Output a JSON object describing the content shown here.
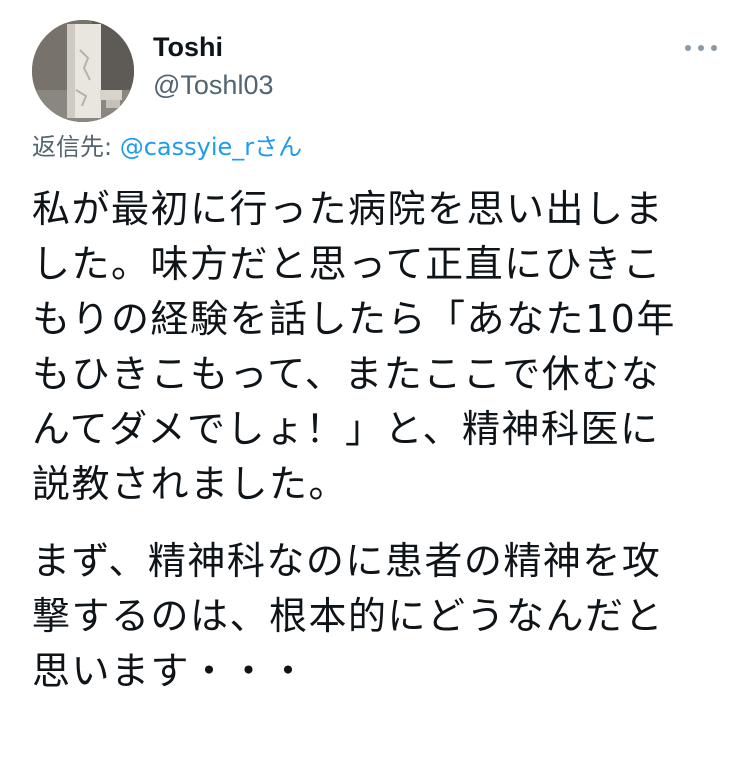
{
  "tweet": {
    "display_name": "Toshi",
    "handle": "@Toshl03",
    "reply_prefix": "返信先: ",
    "reply_mention": "@cassyie_r",
    "reply_suffix": "さん",
    "paragraph1_lines": [
      "私が最初に行った病院を思い出しま",
      "した。味方だと思って正直にひきこ",
      "もりの経験を話したら「あなた10年",
      "もひきこもって、またここで休むな",
      "んてダメでしょ！」と、精神科医に",
      "説教されました。"
    ],
    "paragraph2_lines": [
      "まず、精神科なのに患者の精神を攻",
      "撃するのは、根本的にどうなんだと",
      "思います・・・"
    ]
  },
  "icons": {
    "more": "more-horizontal-icon",
    "avatar": "avatar-image"
  },
  "colors": {
    "text": "#0f1419",
    "secondary": "#536471",
    "mention": "#1d9bf0",
    "more_dots": "#8b98a5"
  }
}
